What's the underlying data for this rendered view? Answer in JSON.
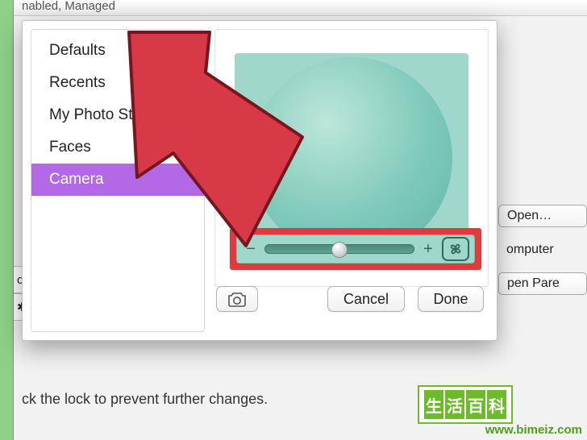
{
  "bg": {
    "header_fragment": "nabled, Managed",
    "left_cells": [
      "og",
      "✱"
    ],
    "right_buttons": [
      "Open…",
      "omputer",
      "pen Pare"
    ],
    "lock_msg": "ck the lock to prevent further changes."
  },
  "dialog": {
    "sidebar": {
      "items": [
        {
          "label": "Defaults",
          "selected": false
        },
        {
          "label": "Recents",
          "selected": false
        },
        {
          "label": "My Photo Strea",
          "selected": false
        },
        {
          "label": "Faces",
          "selected": false
        },
        {
          "label": "Camera",
          "selected": true
        }
      ]
    },
    "slider": {
      "minus": "−",
      "plus": "+",
      "value_pct": 50
    },
    "buttons": {
      "cancel": "Cancel",
      "done": "Done"
    }
  },
  "watermark": {
    "chars": [
      "生",
      "活",
      "百",
      "科"
    ],
    "url": "www.bimeiz.com"
  }
}
